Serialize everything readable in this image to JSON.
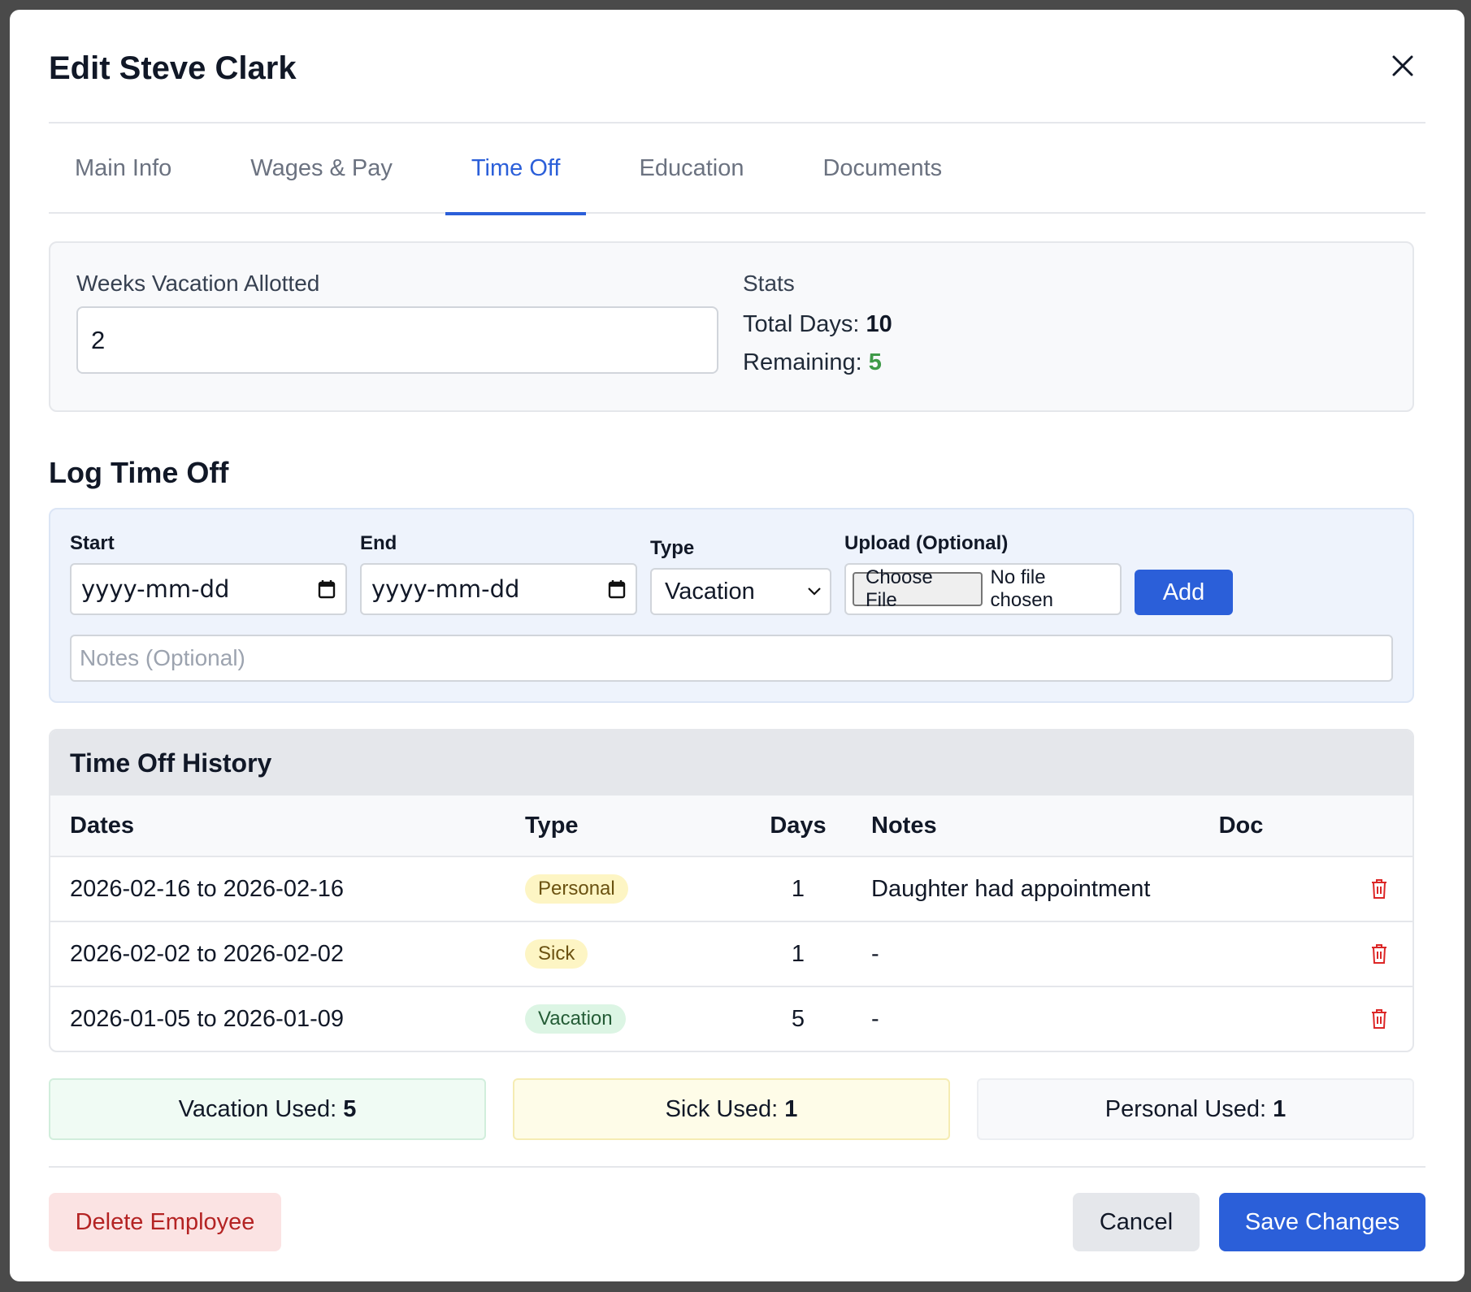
{
  "dialog": {
    "title": "Edit Steve Clark"
  },
  "tabs": [
    {
      "label": "Main Info",
      "active": false
    },
    {
      "label": "Wages & Pay",
      "active": false
    },
    {
      "label": "Time Off",
      "active": true
    },
    {
      "label": "Education",
      "active": false
    },
    {
      "label": "Documents",
      "active": false
    }
  ],
  "allotment": {
    "label": "Weeks Vacation Allotted",
    "value": "2",
    "stats_label": "Stats",
    "total_days_label": "Total Days:",
    "total_days": "10",
    "remaining_label": "Remaining:",
    "remaining": "5"
  },
  "log": {
    "title": "Log Time Off",
    "start_label": "Start",
    "start_value": "yyyy-mm-dd",
    "end_label": "End",
    "end_value": "yyyy-mm-dd",
    "type_label": "Type",
    "type_value": "Vacation",
    "upload_label": "Upload (Optional)",
    "choose_file": "Choose File",
    "no_file": "No file chosen",
    "add_label": "Add",
    "notes_placeholder": "Notes (Optional)"
  },
  "history": {
    "title": "Time Off History",
    "columns": {
      "dates": "Dates",
      "type": "Type",
      "days": "Days",
      "notes": "Notes",
      "doc": "Doc"
    },
    "rows": [
      {
        "dates": "2026-02-16 to 2026-02-16",
        "type": "Personal",
        "days": "1",
        "notes": "Daughter had appointment"
      },
      {
        "dates": "2026-02-02 to 2026-02-02",
        "type": "Sick",
        "days": "1",
        "notes": "-"
      },
      {
        "dates": "2026-01-05 to 2026-01-09",
        "type": "Vacation",
        "days": "5",
        "notes": "-"
      }
    ]
  },
  "used": {
    "vacation_label": "Vacation Used:",
    "vacation": "5",
    "sick_label": "Sick Used:",
    "sick": "1",
    "personal_label": "Personal Used:",
    "personal": "1"
  },
  "footer": {
    "delete_label": "Delete Employee",
    "cancel_label": "Cancel",
    "save_label": "Save Changes"
  },
  "colors": {
    "accent": "#2b5fd9",
    "danger": "#dc2626",
    "success": "#3f9a48"
  }
}
